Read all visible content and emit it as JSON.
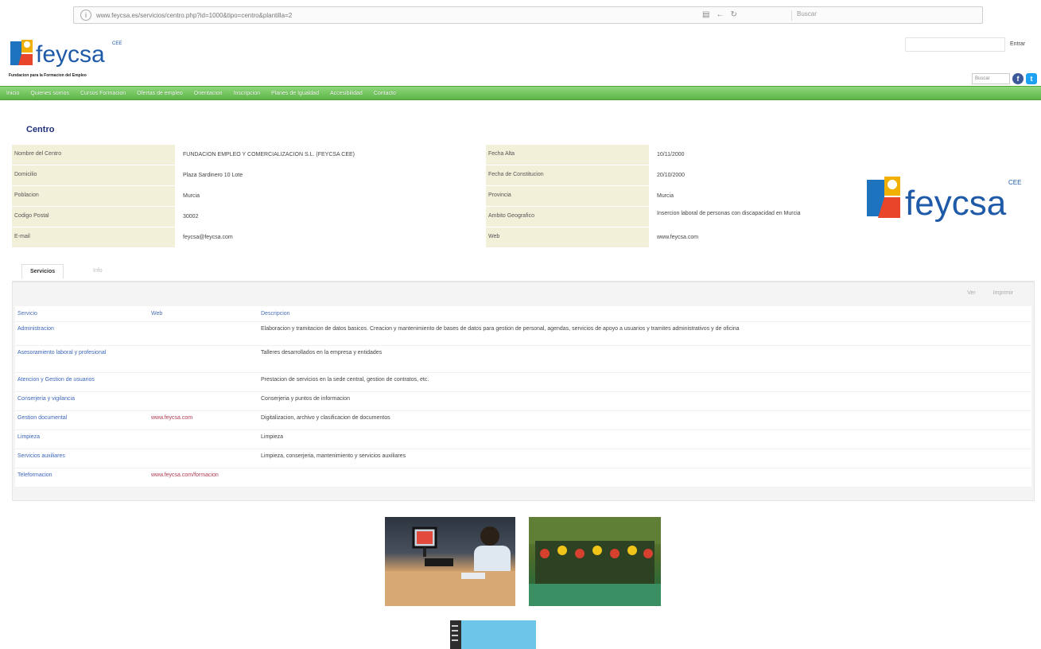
{
  "browser": {
    "url": "www.feycsa.es/servicios/centro.php?id=1000&tipo=centro&plantilla=2",
    "search_placeholder": "Buscar"
  },
  "header": {
    "logo_text": "feycsa",
    "logo_tagline": "Fundacion para la Formacion del Empleo",
    "login_label": "Entrar",
    "search_mini": "Buscar",
    "facebook": "f",
    "twitter": "t"
  },
  "nav": {
    "items": [
      "Inicio",
      "Quienes somos",
      "Cursos Formacion",
      "Ofertas de empleo",
      "Orientacion",
      "Inscripcion",
      "Planes de Igualdad",
      "Accesibilidad",
      "Contacto"
    ]
  },
  "centro": {
    "title": "Centro",
    "left": [
      {
        "label": "Nombre del Centro",
        "value": "FUNDACION EMPLEO Y COMERCIALIZACION S.L. (FEYCSA CEE)"
      },
      {
        "label": "Domicilio",
        "value": "Plaza Sardinero 10 Lote"
      },
      {
        "label": "Poblacion",
        "value": "Murcia"
      },
      {
        "label": "Codigo Postal",
        "value": "30002"
      },
      {
        "label": "E-mail",
        "value": "feycsa@feycsa.com"
      }
    ],
    "right": [
      {
        "label": "Fecha Alta",
        "value": "10/11/2000"
      },
      {
        "label": "Fecha de Constitucion",
        "value": "20/10/2000"
      },
      {
        "label": "Provincia",
        "value": "Murcia"
      },
      {
        "label": "Ambito Geografico",
        "value": "Insercion laboral de personas con discapacidad en Murcia"
      },
      {
        "label": "Web",
        "value": "www.feycsa.com"
      }
    ],
    "logo_text": "feycsa"
  },
  "tabs": {
    "active": "Servicios",
    "inactive": "Info"
  },
  "toolbar": {
    "btn1": "Ver",
    "btn2": "Imprimir"
  },
  "services": {
    "headers": [
      "Servicio",
      "Web",
      "Descripcion"
    ],
    "rows": [
      {
        "servicio": "Administracion",
        "web": "",
        "descripcion": "Elaboracion y tramitacion de datos basicos. Creacion y mantenimiento de bases de datos para gestion de personal, agendas, servicios de apoyo a usuarios y tramites administrativos y de oficina"
      },
      {
        "servicio": "Asesoramiento laboral y profesional",
        "web": "",
        "descripcion": "Talleres desarrollados en la empresa y entidades"
      },
      {
        "servicio": "Atencion y Gestion de usuarios",
        "web": "",
        "descripcion": "Prestacion de servicios en la sede central, gestion de contratos, etc."
      },
      {
        "servicio": "Conserjeria y vigilancia",
        "web": "",
        "descripcion": "Conserjeria y puntos de informacion"
      },
      {
        "servicio": "Gestion documental",
        "web": "www.feycsa.com",
        "descripcion": "Digitalizacion, archivo y clasificacion de documentos"
      },
      {
        "servicio": "Limpieza",
        "web": "",
        "descripcion": "Limpieza"
      },
      {
        "servicio": "Servicios auxiliares",
        "web": "",
        "descripcion": "Limpieza, conserjeria, mantenimiento y servicios auxiliares"
      },
      {
        "servicio": "Teleformacion",
        "web": "www.feycsa.com/formacion",
        "descripcion": ""
      }
    ]
  },
  "colors": {
    "nav_green": "#5db547",
    "label_bg": "#f3f0da",
    "title_blue": "#1f2f7a",
    "link_blue": "#3c66bb",
    "link_red": "#b23a52"
  }
}
